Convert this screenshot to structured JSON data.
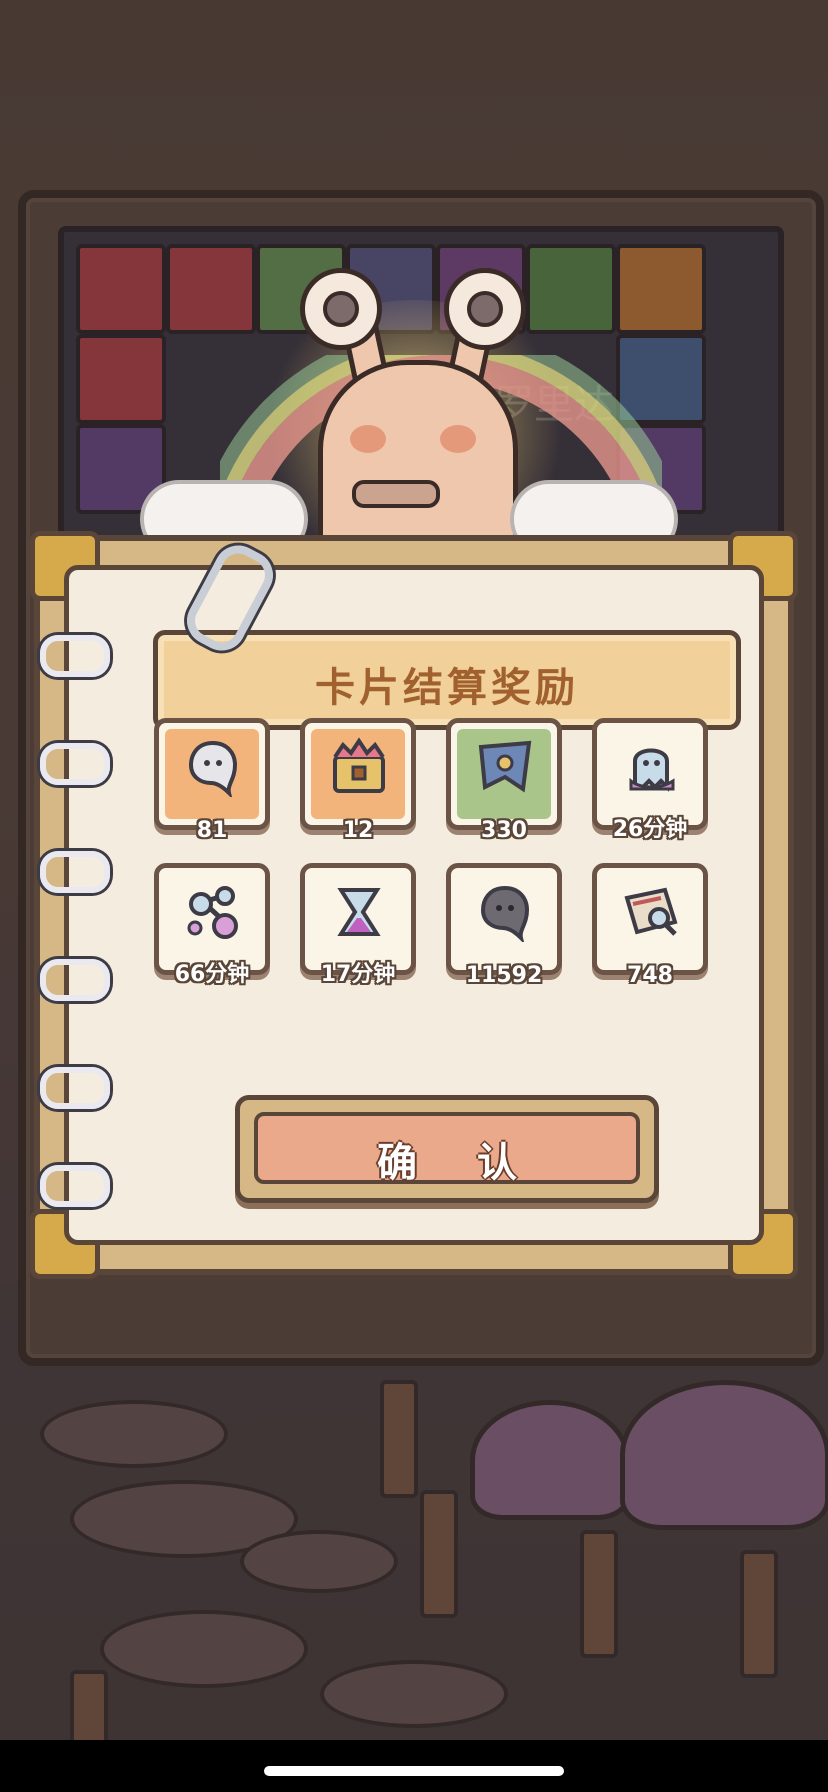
{
  "board": {
    "background_caption": "罗里达"
  },
  "panel": {
    "title": "卡片结算奖励",
    "rewards": [
      {
        "icon": "white-soul-icon",
        "quantity": "81",
        "bg": "#f2b47a"
      },
      {
        "icon": "treasure-chest-icon",
        "quantity": "12",
        "bg": "#f2b47a"
      },
      {
        "icon": "pennant-flag-icon",
        "quantity": "330",
        "bg": "#a9c58a"
      },
      {
        "icon": "ghost-icon",
        "quantity": "26分钟",
        "bg": "#fbf5e8"
      },
      {
        "icon": "flask-icon",
        "quantity": "66分钟",
        "bg": "#fbf5e8"
      },
      {
        "icon": "hourglass-icon",
        "quantity": "17分钟",
        "bg": "#fbf5e8"
      },
      {
        "icon": "dark-soul-icon",
        "quantity": "11592",
        "bg": "#fbf5e8"
      },
      {
        "icon": "magnifier-map-icon",
        "quantity": "748",
        "bg": "#fbf5e8"
      }
    ],
    "confirm_label": "确认"
  },
  "colors": {
    "title_text": "#a0612f",
    "confirm_fill": "#e9a98a",
    "panel_frame": "#d6b887"
  }
}
